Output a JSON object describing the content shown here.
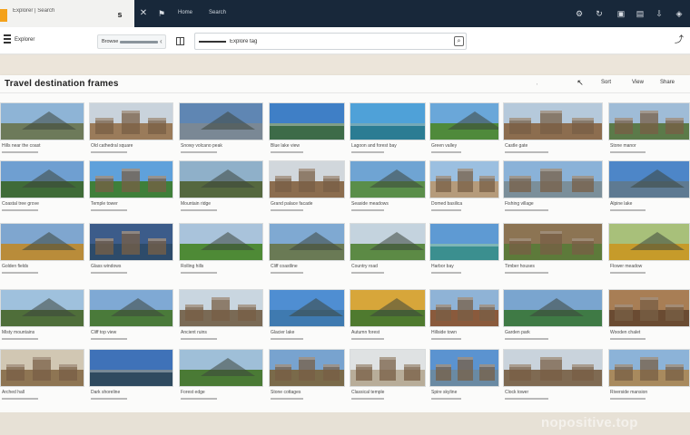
{
  "tab": {
    "title": "Explorer | Search",
    "fav_glyph": "s"
  },
  "topbar": {
    "labels": [
      {
        "text": "Home"
      },
      {
        "text": "Search"
      }
    ]
  },
  "toolbar": {
    "label": "Explorer",
    "filter_label": "Browse",
    "search": {
      "value": "Explore tag"
    }
  },
  "panel": {
    "title": "Travel destination frames",
    "links": [
      "Sort",
      "View",
      "Share"
    ]
  },
  "watermark": "nopositive.top",
  "colors": {
    "topbar": "#18283a",
    "accent": "#f4a21b",
    "panel": "#fbfbfa"
  },
  "rows": [
    [
      {
        "sky": "#8eb4d6",
        "ground": "#6d7a5a",
        "kind": "mountain",
        "c1": "Hills near the coast",
        "c2": ""
      },
      {
        "sky": "#c9d3dc",
        "ground": "#9a7b5a",
        "kind": "building",
        "c1": "Old cathedral square",
        "c2": ""
      },
      {
        "sky": "#5f86b3",
        "ground": "#7a8895",
        "kind": "mountain",
        "c1": "Snowy volcano peak",
        "c2": ""
      },
      {
        "sky": "#3f7fc6",
        "ground": "#3d6b48",
        "kind": "lake",
        "c1": "Blue lake view",
        "c2": ""
      },
      {
        "sky": "#4fa1d8",
        "ground": "#2b7c93",
        "kind": "lake",
        "c1": "Lagoon and forest bay",
        "c2": ""
      },
      {
        "sky": "#6aa7d9",
        "ground": "#4f8a3b",
        "kind": "mountain",
        "c1": "Green valley",
        "c2": ""
      },
      {
        "sky": "#b5c9db",
        "ground": "#8c6d4f",
        "kind": "building",
        "c1": "Castle gate",
        "c2": ""
      },
      {
        "sky": "#9fbcd7",
        "ground": "#5b7a49",
        "kind": "building",
        "c1": "Stone manor",
        "c2": ""
      }
    ],
    [
      {
        "sky": "#6f9fd1",
        "ground": "#3f6b38",
        "kind": "mountain",
        "c1": "Coastal tree grove",
        "c2": ""
      },
      {
        "sky": "#5fa1db",
        "ground": "#3f7f3a",
        "kind": "building",
        "c1": "Temple tower",
        "c2": ""
      },
      {
        "sky": "#8fb0c9",
        "ground": "#55683f",
        "kind": "mountain",
        "c1": "Mountain ridge",
        "c2": ""
      },
      {
        "sky": "#d1d7dc",
        "ground": "#8b6d4f",
        "kind": "building",
        "c1": "Grand palace facade",
        "c2": ""
      },
      {
        "sky": "#6fa4d3",
        "ground": "#5a8e4a",
        "kind": "mountain",
        "c1": "Seaside meadows",
        "c2": ""
      },
      {
        "sky": "#9bbfe0",
        "ground": "#b59b7b",
        "kind": "building",
        "c1": "Domed basilica",
        "c2": ""
      },
      {
        "sky": "#8ab2d8",
        "ground": "#7b8f9a",
        "kind": "building",
        "c1": "Fishing village",
        "c2": ""
      },
      {
        "sky": "#4d86c8",
        "ground": "#5e7a92",
        "kind": "mountain",
        "c1": "Alpine lake",
        "c2": ""
      }
    ],
    [
      {
        "sky": "#7fa6cf",
        "ground": "#b98c3a",
        "kind": "mountain",
        "c1": "Golden fields",
        "c2": ""
      },
      {
        "sky": "#3c5c8a",
        "ground": "#2d4b6a",
        "kind": "building",
        "c1": "Glass windows",
        "c2": ""
      },
      {
        "sky": "#a9c3db",
        "ground": "#4e8a36",
        "kind": "mountain",
        "c1": "Rolling hills",
        "c2": ""
      },
      {
        "sky": "#7fa9d2",
        "ground": "#6a7a55",
        "kind": "mountain",
        "c1": "Cliff coastline",
        "c2": ""
      },
      {
        "sky": "#c4d3de",
        "ground": "#5c8a45",
        "kind": "mountain",
        "c1": "Country road",
        "c2": ""
      },
      {
        "sky": "#5e9ad3",
        "ground": "#3b8f8f",
        "kind": "lake",
        "c1": "Harbor bay",
        "c2": ""
      },
      {
        "sky": "#8c7453",
        "ground": "#5d7a3a",
        "kind": "building",
        "c1": "Timber houses",
        "c2": ""
      },
      {
        "sky": "#a8c07a",
        "ground": "#c69b2a",
        "kind": "mountain",
        "c1": "Flower meadow",
        "c2": ""
      }
    ],
    [
      {
        "sky": "#9fc1dd",
        "ground": "#4f6e3a",
        "kind": "mountain",
        "c1": "Misty mountains",
        "c2": ""
      },
      {
        "sky": "#7fa9d4",
        "ground": "#4a7a3a",
        "kind": "mountain",
        "c1": "Cliff top view",
        "c2": ""
      },
      {
        "sky": "#c9d6e0",
        "ground": "#7a6a55",
        "kind": "building",
        "c1": "Ancient ruins",
        "c2": ""
      },
      {
        "sky": "#4f8ed2",
        "ground": "#3f7ab0",
        "kind": "mountain",
        "c1": "Glacier lake",
        "c2": ""
      },
      {
        "sky": "#d7a63a",
        "ground": "#4f7a2f",
        "kind": "mountain",
        "c1": "Autumn forest",
        "c2": ""
      },
      {
        "sky": "#8fb3d6",
        "ground": "#8a5a3c",
        "kind": "building",
        "c1": "Hillside town",
        "c2": ""
      },
      {
        "sky": "#7aa5cf",
        "ground": "#3f7a45",
        "kind": "mountain",
        "c1": "Garden park",
        "c2": ""
      },
      {
        "sky": "#a87e55",
        "ground": "#6a4b32",
        "kind": "building",
        "c1": "Wooden chalet",
        "c2": ""
      }
    ],
    [
      {
        "sky": "#d1c7b3",
        "ground": "#8e7553",
        "kind": "building",
        "c1": "Arched hall",
        "c2": ""
      },
      {
        "sky": "#3f72b8",
        "ground": "#2f4a5f",
        "kind": "lake",
        "c1": "Dark shoreline",
        "c2": ""
      },
      {
        "sky": "#9fbfd8",
        "ground": "#4a7a35",
        "kind": "mountain",
        "c1": "Forest edge",
        "c2": ""
      },
      {
        "sky": "#78a3cf",
        "ground": "#7a6a4a",
        "kind": "building",
        "c1": "Stone cottages",
        "c2": ""
      },
      {
        "sky": "#dfe2e3",
        "ground": "#b8ad99",
        "kind": "building",
        "c1": "Classical temple",
        "c2": ""
      },
      {
        "sky": "#5b93d0",
        "ground": "#6a8aa3",
        "kind": "building",
        "c1": "Spire skyline",
        "c2": ""
      },
      {
        "sky": "#c9d3dc",
        "ground": "#7f6a52",
        "kind": "building",
        "c1": "Clock tower",
        "c2": ""
      },
      {
        "sky": "#8cb3d8",
        "ground": "#a88a5e",
        "kind": "building",
        "c1": "Riverside mansion",
        "c2": ""
      }
    ]
  ]
}
